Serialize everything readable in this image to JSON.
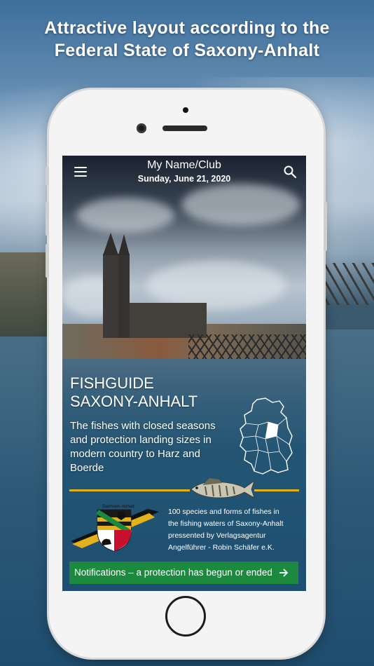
{
  "promo": {
    "headline_line1": "Attractive layout according to the",
    "headline_line2": "Federal State of Saxony-Anhalt"
  },
  "header": {
    "title": "My Name/Club",
    "date": "Sunday, June 21, 2020",
    "menu_icon": "hamburger-menu-icon",
    "search_icon": "search-icon"
  },
  "hero": {
    "title_line1": "FISHGUIDE",
    "title_line2": "SAXONY-ANHALT",
    "description": "The fishes with closed seasons and protection landing sizes in modern country to Harz and Boerde"
  },
  "emblem": {
    "label": "Sachsen-Anhalt"
  },
  "info": {
    "line1": "100 species and forms of fishes in",
    "line2": "the fishing waters of Saxony-Anhalt",
    "line3": "pressented by Verlagsagentur",
    "line4": "Angelführer - Robin Schäfer e.K."
  },
  "notification": {
    "label": "Notifications – a protection has begun or ended"
  },
  "colors": {
    "accent_green": "#1c8a3e",
    "gold": "#e3b11c"
  }
}
